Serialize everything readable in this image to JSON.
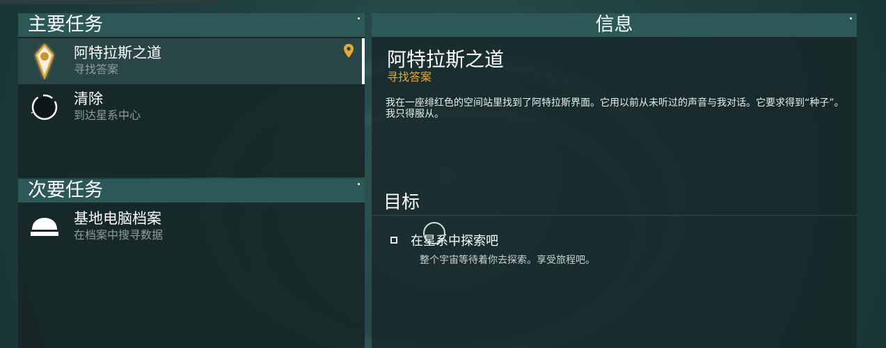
{
  "colors": {
    "header_bg": "#2c5858",
    "panel_bg": "#172526",
    "accent_gold": "#e5a93a",
    "text_white": "#ffffff",
    "text_muted": "#8f9d9d"
  },
  "main_missions": {
    "title": "主要任务",
    "items": [
      {
        "title": "阿特拉斯之道",
        "subtitle": "寻找答案",
        "icon": "atlas-gem-icon",
        "selected": true,
        "tracked": true
      },
      {
        "title": "清除",
        "subtitle": "到达星系中心",
        "icon": "galaxy-ring-icon",
        "selected": false
      }
    ]
  },
  "secondary_missions": {
    "title": "次要任务",
    "items": [
      {
        "title": "基地电脑档案",
        "subtitle": "在档案中搜寻数据",
        "icon": "base-dome-icon"
      }
    ]
  },
  "info": {
    "header": "信息",
    "title": "阿特拉斯之道",
    "subtitle": "寻找答案",
    "description": "我在一座绯红色的空间站里找到了阿特拉斯界面。它用以前从未听过的声音与我对话。它要求得到“种子”。我只得服从。",
    "goals_header": "目标",
    "objective": {
      "label": "在星系中探索吧",
      "description": "整个宇宙等待着你去探索。享受旅程吧。",
      "checked": false
    }
  }
}
